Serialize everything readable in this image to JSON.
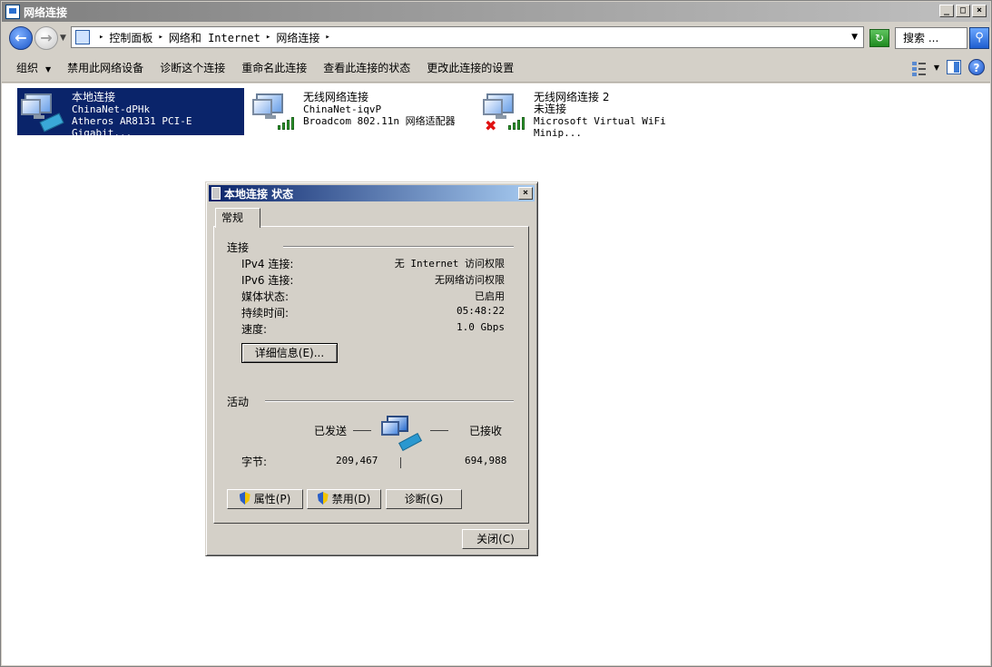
{
  "window": {
    "title": "网络连接",
    "min": "_",
    "max": "□",
    "close": "×"
  },
  "address": {
    "crumbs": [
      "控制面板",
      "网络和 Internet",
      "网络连接"
    ],
    "search_placeholder": "搜索 ..."
  },
  "commands": {
    "organize": "组织",
    "disable_device": "禁用此网络设备",
    "diagnose": "诊断这个连接",
    "rename": "重命名此连接",
    "view_status": "查看此连接的状态",
    "change_settings": "更改此连接的设置"
  },
  "connections": [
    {
      "name": "本地连接",
      "network": "ChinaNet-dPHk",
      "adapter": "Atheros AR8131 PCI-E Gigabit..."
    },
    {
      "name": "无线网络连接",
      "network": "ChinaNet-iqvP",
      "adapter": "Broadcom 802.11n 网络适配器"
    },
    {
      "name": "无线网络连接 2",
      "network": "未连接",
      "adapter": "Microsoft Virtual WiFi Minip..."
    }
  ],
  "dialog": {
    "title": "本地连接 状态",
    "close": "×",
    "tab": "常规",
    "connection_group": "连接",
    "rows": [
      {
        "k": "IPv4 连接:",
        "v": "无 Internet 访问权限"
      },
      {
        "k": "IPv6 连接:",
        "v": "无网络访问权限"
      },
      {
        "k": "媒体状态:",
        "v": "已启用"
      },
      {
        "k": "持续时间:",
        "v": "05:48:22"
      },
      {
        "k": "速度:",
        "v": "1.0 Gbps"
      }
    ],
    "details_button": "详细信息(E)...",
    "activity_group": "活动",
    "sent_label": "已发送",
    "received_label": "已接收",
    "bytes_label": "字节:",
    "bytes_sent": "209,467",
    "bytes_received": "694,988",
    "properties_button": "属性(P)",
    "disable_button": "禁用(D)",
    "diagnose_button": "诊断(G)",
    "close_button": "关闭(C)"
  }
}
